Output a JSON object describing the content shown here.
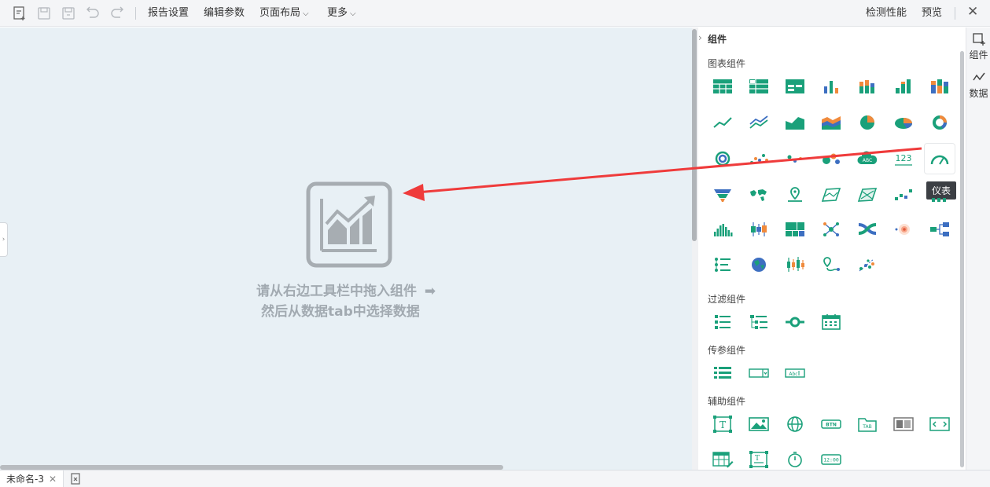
{
  "toolbar": {
    "menus": [
      {
        "label": "报告设置",
        "has_caret": false
      },
      {
        "label": "编辑参数",
        "has_caret": false
      },
      {
        "label": "页面布局",
        "has_caret": true
      },
      {
        "label": "更多",
        "has_caret": true
      }
    ],
    "right": {
      "check": "检测性能",
      "preview": "预览",
      "close": "✕"
    }
  },
  "canvas": {
    "hint_line1": "请从右边工具栏中拖入组件",
    "hint_line2": "然后从数据tab中选择数据",
    "hint_arrow": "➡"
  },
  "panel": {
    "title": "组件",
    "sections": {
      "charts": "图表组件",
      "filters": "过滤组件",
      "params": "传参组件",
      "aux": "辅助组件"
    },
    "tooltip": "仪表",
    "accent": "#1aa07a",
    "accent_blue": "#3d6fc1",
    "accent_orange": "#f08a3c"
  },
  "right_strip": {
    "components": "组件",
    "data": "数据"
  },
  "bottom": {
    "tab_name": "未命名-3",
    "tab_close": "✕"
  },
  "annotation_arrow_color": "#ef3b3b"
}
